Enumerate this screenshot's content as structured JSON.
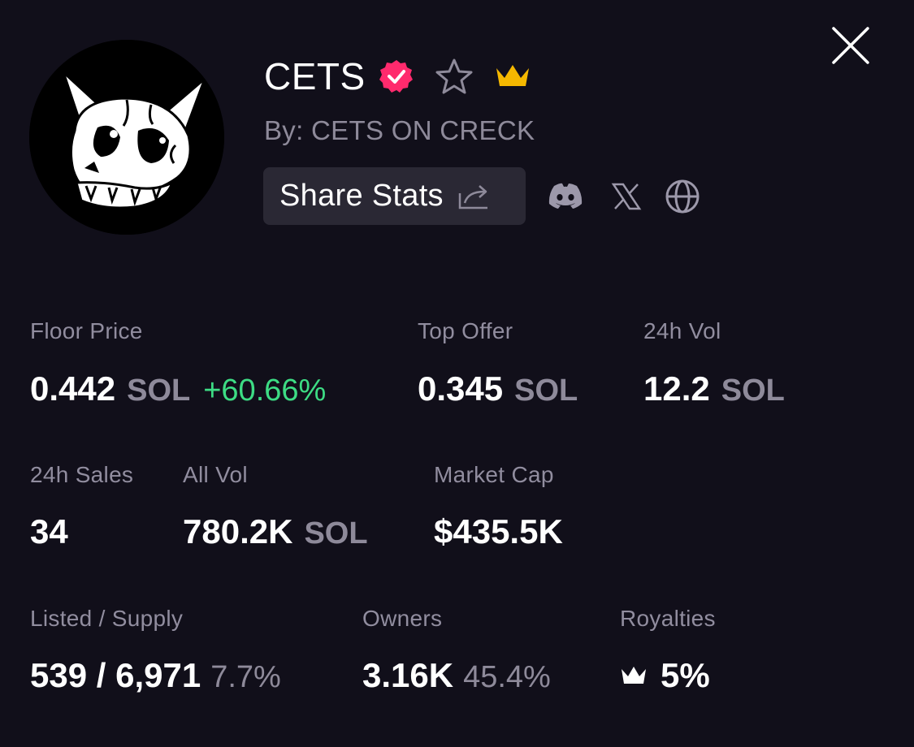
{
  "collection": {
    "name": "CETS",
    "creator": "By: CETS ON CRECK"
  },
  "actions": {
    "share_label": "Share Stats"
  },
  "icons": {
    "verified": "verified-badge-icon",
    "favorite": "star-icon",
    "featured": "crown-icon",
    "share": "share-icon",
    "discord": "discord-icon",
    "x": "x-icon",
    "website": "globe-icon",
    "close": "close-icon"
  },
  "colors": {
    "background": "#110f1a",
    "verified": "#ff2a6d",
    "crown": "#f5b800",
    "positive": "#3ddc84",
    "muted": "#8e8a9a",
    "button": "#2a2834"
  },
  "stats": {
    "floor_price": {
      "label": "Floor Price",
      "value": "0.442",
      "unit": "SOL",
      "change": "+60.66%"
    },
    "top_offer": {
      "label": "Top Offer",
      "value": "0.345",
      "unit": "SOL"
    },
    "vol_24h": {
      "label": "24h Vol",
      "value": "12.2",
      "unit": "SOL"
    },
    "sales_24h": {
      "label": "24h Sales",
      "value": "34"
    },
    "all_vol": {
      "label": "All Vol",
      "value": "780.2K",
      "unit": "SOL"
    },
    "market_cap": {
      "label": "Market Cap",
      "value": "$435.5K"
    },
    "listed_supply": {
      "label": "Listed / Supply",
      "value": "539 / 6,971",
      "pct": "7.7%"
    },
    "owners": {
      "label": "Owners",
      "value": "3.16K",
      "pct": "45.4%"
    },
    "royalties": {
      "label": "Royalties",
      "value": "5%"
    }
  }
}
